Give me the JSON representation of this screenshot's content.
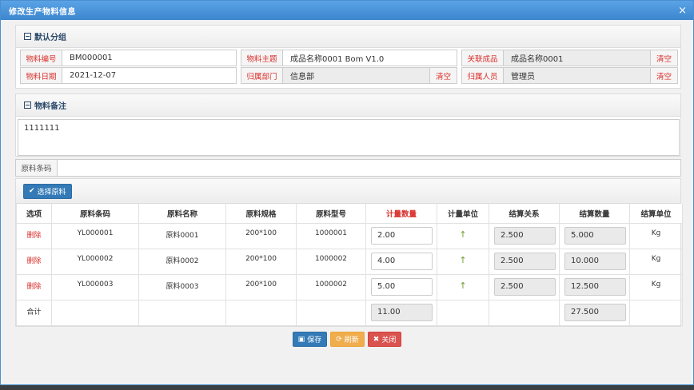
{
  "window": {
    "title": "修改生产物料信息",
    "close_glyph": "×"
  },
  "section_default": {
    "title": "默认分组"
  },
  "fields": {
    "code": {
      "label": "物料编号",
      "value": "BM000001"
    },
    "subject": {
      "label": "物料主题",
      "value": "成品名称0001 Bom V1.0"
    },
    "product": {
      "label": "关联成品",
      "value": "成品名称0001",
      "clear": "清空"
    },
    "date": {
      "label": "物料日期",
      "value": "2021-12-07"
    },
    "dept": {
      "label": "归属部门",
      "value": "信息部",
      "clear": "清空"
    },
    "person": {
      "label": "归属人员",
      "value": "管理员",
      "clear": "清空"
    }
  },
  "section_remark": {
    "title": "物料备注",
    "value": "1111111"
  },
  "barcode": {
    "label": "原料条码",
    "value": ""
  },
  "toolbar": {
    "select_label": "选择原料"
  },
  "table": {
    "headers": [
      "选项",
      "原料条码",
      "原料名称",
      "原料规格",
      "原料型号",
      "计量数量",
      "计量单位",
      "结算关系",
      "结算数量",
      "结算单位"
    ],
    "rows": [
      {
        "op": "删除",
        "code": "YL000001",
        "name": "原料0001",
        "spec": "200*100",
        "model": "1000001",
        "qty": "2.00",
        "unit": "↑",
        "ratio": "2.500",
        "settle": "5.000",
        "settle_unit": "Kg"
      },
      {
        "op": "删除",
        "code": "YL000002",
        "name": "原料0002",
        "spec": "200*100",
        "model": "1000002",
        "qty": "4.00",
        "unit": "↑",
        "ratio": "2.500",
        "settle": "10.000",
        "settle_unit": "Kg"
      },
      {
        "op": "删除",
        "code": "YL000003",
        "name": "原料0003",
        "spec": "200*100",
        "model": "1000002",
        "qty": "5.00",
        "unit": "↑",
        "ratio": "2.500",
        "settle": "12.500",
        "settle_unit": "Kg"
      }
    ],
    "total": {
      "label": "合计",
      "qty": "11.00",
      "settle": "27.500"
    }
  },
  "footer": {
    "save": "保存",
    "refresh": "刷新",
    "close": "关闭"
  }
}
